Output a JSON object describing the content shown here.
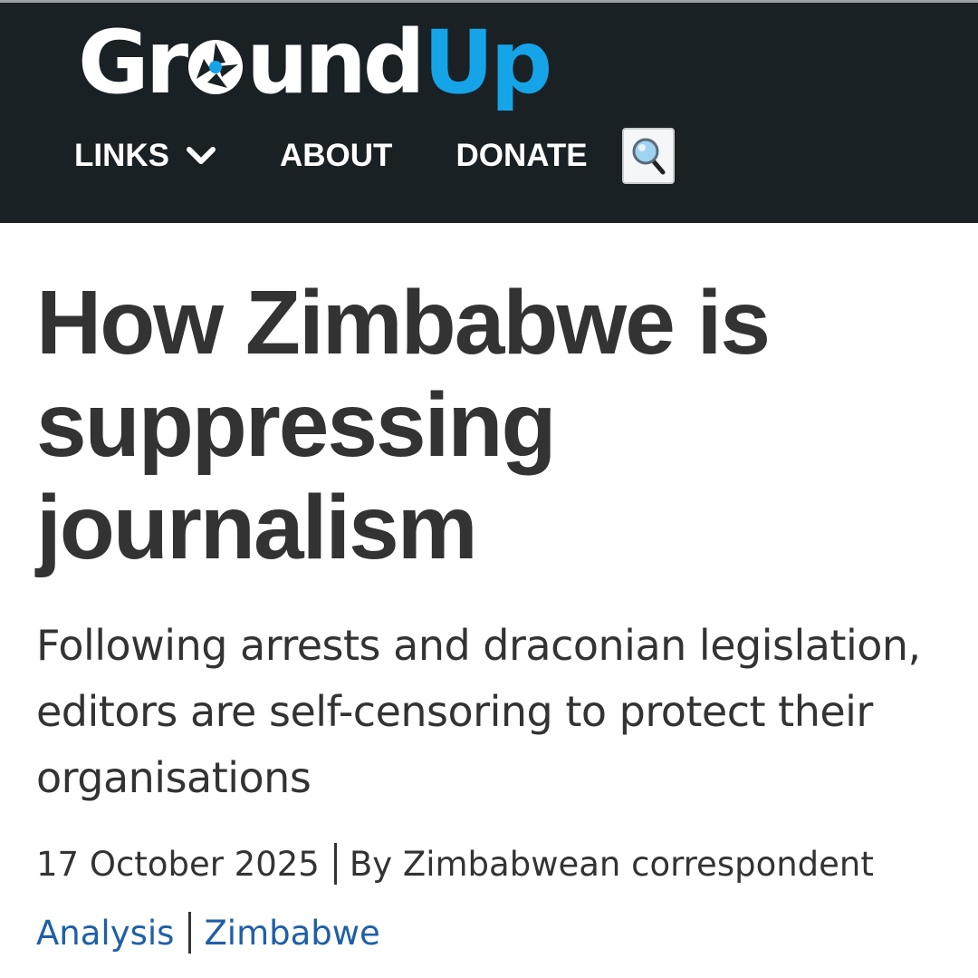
{
  "header": {
    "logo": {
      "part1_before": "Gr",
      "part1_after": "und",
      "part2": "Up",
      "aperture_icon": "camera-aperture-icon",
      "colors": {
        "ground": "#ffffff",
        "up": "#15a4e8",
        "background": "#1a2124"
      }
    },
    "nav": {
      "links_label": "LINKS",
      "links_icon": "chevron-down-icon",
      "about_label": "ABOUT",
      "donate_label": "DONATE",
      "search_icon": "magnifying-glass-icon"
    }
  },
  "article": {
    "title": "How Zimbabwe is suppressing journalism",
    "subtitle": "Following arrests and draconian legislation, editors are self-censoring to protect their organisations",
    "date": "17 October 2025",
    "byline": "By Zimbabwean correspondent",
    "tags": [
      "Analysis",
      "Zimbabwe"
    ],
    "tag_color": "#1f5fa8"
  }
}
